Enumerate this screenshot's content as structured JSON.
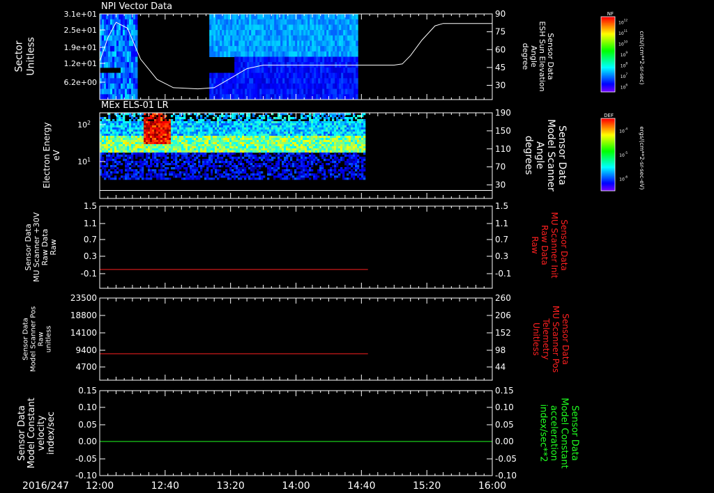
{
  "figure": {
    "date_label": "2016/247",
    "time_ticks": [
      "12:00",
      "12:40",
      "13:20",
      "14:00",
      "14:40",
      "15:20",
      "16:00"
    ]
  },
  "chart_data": [
    {
      "type": "heatmap",
      "title": "NPI Vector Data",
      "ylabel": [
        "Sector",
        "Unitless"
      ],
      "yticks": [
        "3.1e+01",
        "2.5e+01",
        "1.9e+01",
        "1.2e+01",
        "6.2e+00"
      ],
      "xlim": [
        "12:00",
        "16:00"
      ],
      "data_segments": [
        [
          "12:00",
          "12:23"
        ],
        [
          "13:07",
          "14:37"
        ]
      ],
      "overlay_line": {
        "label": [
          "Sensor Data",
          "ESH Sun Elevation",
          "Angle",
          "degree"
        ],
        "ylim": [
          18,
          90
        ],
        "yticks": [
          "90",
          "75",
          "60",
          "45",
          "30"
        ],
        "x": [
          "12:00",
          "12:05",
          "12:10",
          "12:17",
          "12:25",
          "12:35",
          "12:45",
          "13:00",
          "13:10",
          "13:20",
          "13:30",
          "13:40",
          "14:00",
          "14:20",
          "14:40",
          "15:00",
          "15:05",
          "15:10",
          "15:17",
          "15:25",
          "15:30",
          "16:00"
        ],
        "y": [
          50,
          70,
          83,
          78,
          52,
          35,
          28,
          27,
          28,
          36,
          44,
          47,
          47,
          47,
          47,
          47,
          48,
          55,
          68,
          80,
          82,
          82
        ]
      },
      "colorbar": {
        "label": "NF",
        "unit": "cnts/(cm**2-sr-sec)",
        "ticks": [
          "10^12",
          "10^11",
          "10^10",
          "10^9",
          "10^8",
          "10^7",
          "10^6"
        ]
      }
    },
    {
      "type": "heatmap",
      "title": "MEx ELS-01 LR",
      "ylabel": [
        "Electron Energy",
        "eV"
      ],
      "ylog": true,
      "yticks": [
        "10^2",
        "10^1"
      ],
      "xlim": [
        "12:00",
        "16:00"
      ],
      "data_segments": [
        [
          "12:00",
          "14:42"
        ]
      ],
      "overlay_line": {
        "label": [
          "Sensor Data",
          "Model Scanner",
          "Angle",
          "degrees"
        ],
        "ylim": [
          0,
          190
        ],
        "yticks": [
          "190",
          "150",
          "110",
          "70",
          "30"
        ],
        "x": [
          "12:00",
          "16:00"
        ],
        "y": [
          10,
          10
        ]
      },
      "colorbar": {
        "label": "DEF",
        "unit": "ergs/(cm**2-sr-sec-eV)",
        "ticks": [
          "10^-4",
          "10^-5",
          "10^-6"
        ]
      }
    },
    {
      "type": "line",
      "ylabel": [
        "Sensor Data",
        "MU Scanner +30V",
        "Raw Data",
        "Raw"
      ],
      "ylim": [
        -0.3,
        1.5
      ],
      "yticks": [
        "1.5",
        "1.1",
        "0.7",
        "0.3",
        "-0.1"
      ],
      "right_label": [
        "Sensor Data",
        "MU Scanner Init",
        "Raw Data",
        "Raw"
      ],
      "right_yticks": [
        "1.5",
        "1.1",
        "0.7",
        "0.3",
        "-0.1"
      ],
      "series": [
        {
          "color": "#ff2020",
          "x": [
            "12:00",
            "14:44"
          ],
          "y": [
            0,
            0
          ]
        }
      ]
    },
    {
      "type": "line",
      "ylabel": [
        "Sensor Data",
        "Model Scanner Pos",
        "Raw",
        "unitless"
      ],
      "ylim": [
        0,
        23500
      ],
      "yticks": [
        "23500",
        "18800",
        "14100",
        "9400",
        "4700"
      ],
      "right_label": [
        "Sensor Data",
        "MU Scanner Pos",
        "Telemetry",
        "Unitless"
      ],
      "right_yticks": [
        "260",
        "206",
        "152",
        "98",
        "44"
      ],
      "series": [
        {
          "color": "#ff2020",
          "x": [
            "12:00",
            "14:44"
          ],
          "y": [
            7200,
            7200
          ]
        }
      ]
    },
    {
      "type": "line",
      "ylabel": [
        "Sensor Data",
        "Model Constant",
        "velocity",
        "index/sec"
      ],
      "ylim": [
        -0.1,
        0.15
      ],
      "yticks": [
        "0.15",
        "0.10",
        "0.05",
        "0.00",
        "-0.05",
        "-0.10"
      ],
      "right_label": [
        "Sensor Data",
        "Model Constant",
        "acceleration",
        "index/sec**2"
      ],
      "right_yticks": [
        "0.15",
        "0.10",
        "0.05",
        "0.00",
        "-0.05",
        "-0.10"
      ],
      "series": [
        {
          "color": "#20ff20",
          "x": [
            "12:00",
            "16:00"
          ],
          "y": [
            0,
            0
          ]
        }
      ]
    }
  ],
  "colors": {
    "axis": "#ffffff",
    "red_label": "#ff2020",
    "green_label": "#20ff20"
  }
}
